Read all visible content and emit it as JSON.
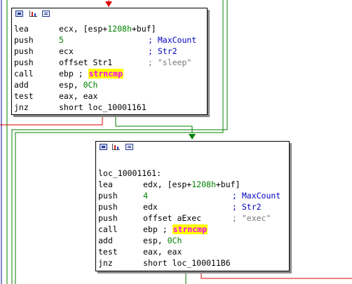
{
  "colors": {
    "edge_false": "#e00000",
    "edge_true": "#008000",
    "edge_jump": "#0000a0",
    "number": "#008000",
    "comment": "#0000c0",
    "string": "#7a7a7a",
    "import_fg": "#ff00ff",
    "import_bg": "#ffff00"
  },
  "header_icons": [
    "graph-overview-icon",
    "bar-chart-icon",
    "listing-view-icon"
  ],
  "block1": {
    "lines": [
      {
        "mn": "lea",
        "op": [
          "ecx, [esp+",
          "1208h",
          "+buf]"
        ]
      },
      {
        "mn": "push",
        "op": "5",
        "cmt": "; MaxCount"
      },
      {
        "mn": "push",
        "op": "ecx",
        "cmt": "; Str2"
      },
      {
        "mn": "push",
        "op": "offset Str1",
        "cmt": "; \"sleep\""
      },
      {
        "mn": "call",
        "op": "ebp ;",
        "fn": "strncmp"
      },
      {
        "mn": "add",
        "op": [
          "esp, ",
          "0Ch"
        ]
      },
      {
        "mn": "test",
        "op": "eax, eax"
      },
      {
        "mn": "jnz",
        "op": "short loc_10001161"
      }
    ]
  },
  "block2": {
    "label": "loc_10001161:",
    "lines": [
      {
        "mn": "lea",
        "op": [
          "edx, [esp+",
          "1208h",
          "+buf]"
        ]
      },
      {
        "mn": "push",
        "op": "4",
        "cmt": "; MaxCount"
      },
      {
        "mn": "push",
        "op": "edx",
        "cmt": "; Str2"
      },
      {
        "mn": "push",
        "op": "offset aExec",
        "cmt": "; \"exec\""
      },
      {
        "mn": "call",
        "op": "ebp ;",
        "fn": "strncmp"
      },
      {
        "mn": "add",
        "op": [
          "esp, ",
          "0Ch"
        ]
      },
      {
        "mn": "test",
        "op": "eax, eax"
      },
      {
        "mn": "jnz",
        "op": "short loc_100011B6"
      }
    ]
  }
}
